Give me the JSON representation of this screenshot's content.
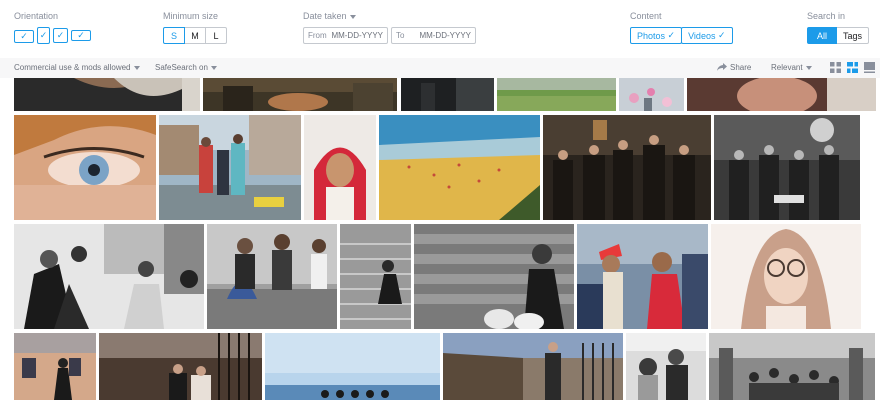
{
  "filters": {
    "orientation": {
      "label": "Orientation",
      "options": [
        "landscape",
        "portrait",
        "square",
        "panorama"
      ]
    },
    "min_size": {
      "label": "Minimum size",
      "options": [
        "S",
        "M",
        "L"
      ],
      "selected": "S"
    },
    "date_taken": {
      "label": "Date taken",
      "from_label": "From",
      "from_placeholder": "MM-DD-YYYY",
      "to_label": "To",
      "to_placeholder": "MM-DD-YYYY"
    },
    "content": {
      "label": "Content",
      "photos": "Photos",
      "videos": "Videos"
    },
    "search_in": {
      "label": "Search in",
      "all": "All",
      "tags": "Tags",
      "selected": "All"
    }
  },
  "subbar": {
    "license": "Commercial use & mods allowed",
    "safesearch": "SafeSearch on",
    "share": "Share",
    "sort": "Relevant"
  },
  "colors": {
    "accent": "#1c9be9",
    "subbar_bg": "#f7f7f8"
  },
  "photos": [
    {
      "id": "r0-1",
      "desc": "woman with long hair"
    },
    {
      "id": "r0-2",
      "desc": "people and dog"
    },
    {
      "id": "r0-3",
      "desc": "dark scene"
    },
    {
      "id": "r0-4",
      "desc": "grass field"
    },
    {
      "id": "r0-5",
      "desc": "crowd with flowers"
    },
    {
      "id": "r0-6",
      "desc": "smiling person"
    },
    {
      "id": "r1-1",
      "desc": "close-up blue eye"
    },
    {
      "id": "r1-2",
      "desc": "family on promenade"
    },
    {
      "id": "r1-3",
      "desc": "girl in red hijab"
    },
    {
      "id": "r1-4",
      "desc": "crowded beach"
    },
    {
      "id": "r1-5",
      "desc": "vintage group seated"
    },
    {
      "id": "r1-6",
      "desc": "men in suits with trophies"
    },
    {
      "id": "r2-1",
      "desc": "street walkers black and white"
    },
    {
      "id": "r2-2",
      "desc": "women sitting on wall"
    },
    {
      "id": "r2-3",
      "desc": "woman on steps"
    },
    {
      "id": "r2-4",
      "desc": "woman with shopping bags"
    },
    {
      "id": "r2-5",
      "desc": "wedding couple"
    },
    {
      "id": "r2-6",
      "desc": "girl with round glasses"
    },
    {
      "id": "r3-1",
      "desc": "building with person"
    },
    {
      "id": "r3-2",
      "desc": "couple by gate"
    },
    {
      "id": "r3-3",
      "desc": "sea horizon"
    },
    {
      "id": "r3-4",
      "desc": "people by iron fence"
    },
    {
      "id": "r3-5",
      "desc": "children portrait"
    },
    {
      "id": "r3-6",
      "desc": "subway train interior"
    }
  ]
}
